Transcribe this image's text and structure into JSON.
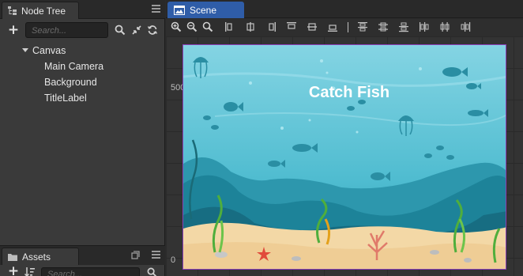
{
  "node_tree": {
    "tab_title": "Node Tree",
    "search_placeholder": "Search...",
    "items": [
      {
        "label": "Canvas",
        "expanded": true
      },
      {
        "label": "Main Camera"
      },
      {
        "label": "Background"
      },
      {
        "label": "TitleLabel"
      }
    ]
  },
  "assets": {
    "tab_title": "Assets",
    "search_placeholder": "Search..."
  },
  "scene": {
    "tab_title": "Scene",
    "ruler_labels": [
      "500",
      "0"
    ],
    "canvas_title": "Catch Fish"
  },
  "colors": {
    "scene_tab_active": "#2f5da8",
    "canvas_border": "#8a3fb8",
    "water_top": "#7ed2e2",
    "water_bottom": "#2fa9bf",
    "sand": "#f3d8a6"
  }
}
